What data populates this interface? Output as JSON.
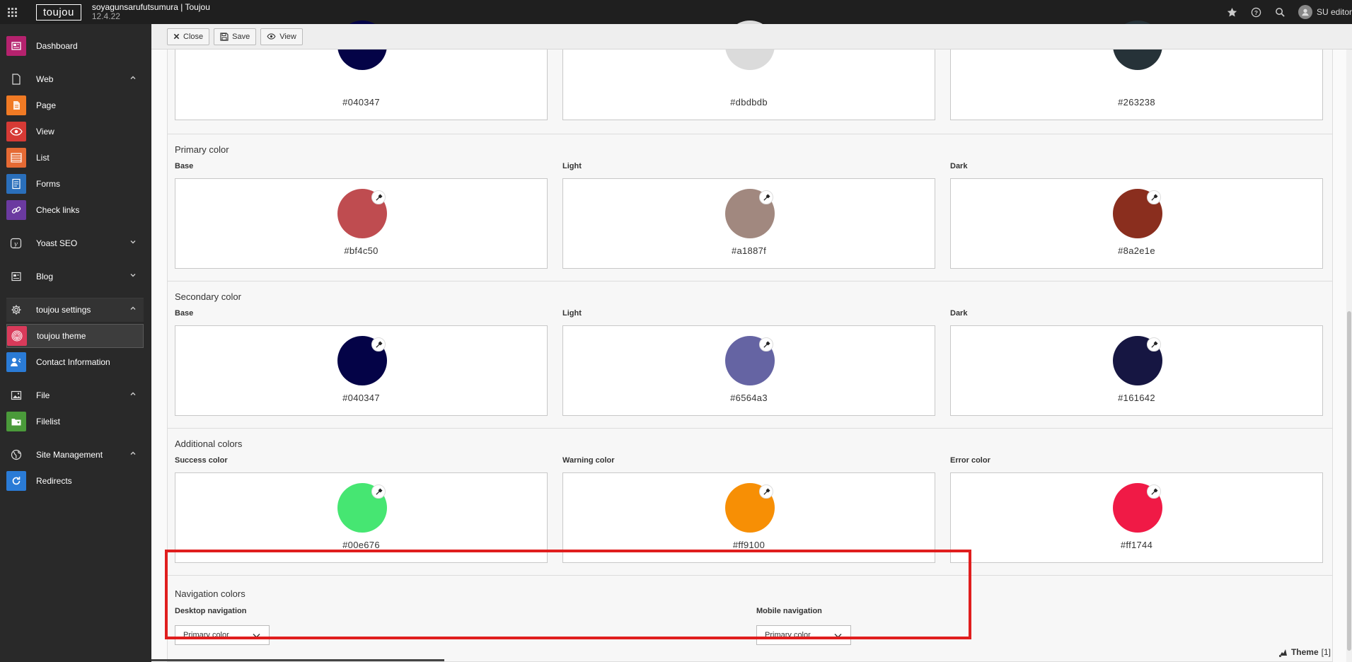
{
  "topbar": {
    "logo": "toujou",
    "site_title": "soyagunsarufutsumura | Toujou",
    "version": "12.4.22",
    "user_name": "SU editor"
  },
  "sidebar": {
    "items": [
      {
        "label": "Dashboard",
        "icon": "dashboard-icon",
        "color": "#b5226e"
      },
      {
        "label": "Web",
        "icon": "page-tree-icon",
        "group": true
      },
      {
        "label": "Page",
        "icon": "page-icon",
        "color": "#f07a24"
      },
      {
        "label": "View",
        "icon": "eye-icon",
        "color": "#d63a35"
      },
      {
        "label": "List",
        "icon": "list-icon",
        "color": "#e56a34"
      },
      {
        "label": "Forms",
        "icon": "forms-icon",
        "color": "#2a6fbb"
      },
      {
        "label": "Check links",
        "icon": "link-icon",
        "color": "#6b3aa0"
      },
      {
        "label": "Yoast SEO",
        "icon": "yoast-icon",
        "group": true
      },
      {
        "label": "Blog",
        "icon": "blog-icon",
        "group": true
      },
      {
        "label": "toujou settings",
        "icon": "gear-icon",
        "group": true
      },
      {
        "label": "toujou theme",
        "icon": "fingerprint-icon",
        "color": "#d93a5a"
      },
      {
        "label": "Contact Information",
        "icon": "contact-icon",
        "color": "#2a7bd6"
      },
      {
        "label": "File",
        "icon": "image-icon",
        "group": true
      },
      {
        "label": "Filelist",
        "icon": "filelist-icon",
        "color": "#4a9a3a"
      },
      {
        "label": "Site Management",
        "icon": "globe-icon",
        "group": true
      },
      {
        "label": "Redirects",
        "icon": "redirect-icon",
        "color": "#2a7bd6"
      }
    ]
  },
  "toolbar": {
    "close_label": "Close",
    "save_label": "Save",
    "view_label": "View"
  },
  "top_partial": {
    "hex1": "#040347",
    "hex2": "#dbdbdb",
    "hex3": "#263238",
    "color1": "#040347",
    "color2": "#dbdbdb",
    "color3": "#263238"
  },
  "sections": [
    {
      "title": "Primary color",
      "columns": [
        {
          "label": "Base",
          "hex": "#bf4c50"
        },
        {
          "label": "Light",
          "hex": "#a1887f"
        },
        {
          "label": "Dark",
          "hex": "#8a2e1e"
        }
      ]
    },
    {
      "title": "Secondary color",
      "columns": [
        {
          "label": "Base",
          "hex": "#040347"
        },
        {
          "label": "Light",
          "hex": "#6564a3"
        },
        {
          "label": "Dark",
          "hex": "#161642"
        }
      ]
    },
    {
      "title": "Additional colors",
      "columns": [
        {
          "label": "Success color",
          "hex": "#00e676"
        },
        {
          "label": "Warning color",
          "hex": "#ff9100"
        },
        {
          "label": "Error color",
          "hex": "#ff1744"
        }
      ]
    }
  ],
  "navigation": {
    "title": "Navigation colors",
    "desktop_label": "Desktop navigation",
    "desktop_value": "Primary color",
    "mobile_label": "Mobile navigation",
    "mobile_value": "Primary color"
  },
  "footer": {
    "theme_label": "Theme",
    "theme_count": "[1]"
  },
  "colors": {
    "highlight": "#e01e1e",
    "topbar_bg": "#1f1f1f",
    "sidebar_bg": "#292929"
  }
}
